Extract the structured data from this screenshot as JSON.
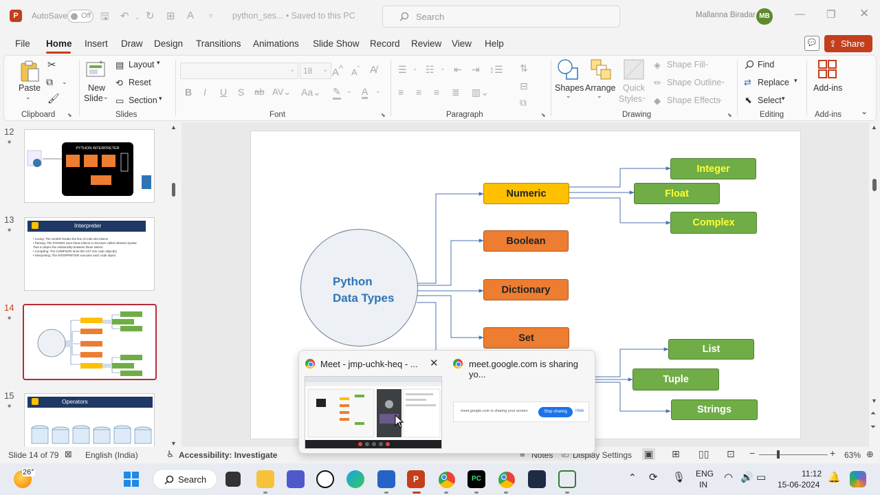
{
  "titlebar": {
    "app_letter": "P",
    "autosave_label": "AutoSave",
    "autosave_state": "Off",
    "doc_title": "python_ses... • Saved to this PC",
    "search_placeholder": "Search",
    "user_name": "Mallanna Biradar",
    "user_initials": "MB"
  },
  "menu": {
    "tabs": [
      "File",
      "Home",
      "Insert",
      "Draw",
      "Design",
      "Transitions",
      "Animations",
      "Slide Show",
      "Record",
      "Review",
      "View",
      "Help"
    ],
    "active": "Home",
    "share_label": "Share"
  },
  "ribbon": {
    "clipboard": {
      "paste": "Paste",
      "group": "Clipboard"
    },
    "slides": {
      "new_slide_1": "New",
      "new_slide_2": "Slide",
      "layout": "Layout",
      "reset": "Reset",
      "section": "Section",
      "group": "Slides"
    },
    "font": {
      "font_size": "18",
      "group": "Font"
    },
    "paragraph": {
      "group": "Paragraph"
    },
    "drawing": {
      "shapes": "Shapes",
      "arrange": "Arrange",
      "quick_1": "Quick",
      "quick_2": "Styles",
      "shape_fill": "Shape Fill",
      "shape_outline": "Shape Outline",
      "shape_effects": "Shape Effects",
      "group": "Drawing"
    },
    "editing": {
      "find": "Find",
      "replace": "Replace",
      "select": "Select",
      "group": "Editing"
    },
    "addins": {
      "label": "Add-ins",
      "group": "Add-ins"
    }
  },
  "slides_panel": {
    "slides": [
      {
        "number": "12",
        "caption": "PYTHON INTERPRETER"
      },
      {
        "number": "13",
        "caption": "Interpreter",
        "lines": [
          "• Lexing: The LEXER breaks the line of code into tokens",
          "• Parsing: The PARSER uses these tokens to structure called Abstract Syntax Tree to depict the relationship between these tokens",
          "• Compiling: The COMPILER turns this AST into code object(s)",
          "• Interpreting: The INTERPRETER executes each code object"
        ]
      },
      {
        "number": "14",
        "caption": ""
      },
      {
        "number": "15",
        "caption": "Operators"
      }
    ],
    "current": "14"
  },
  "slide": {
    "center_line1": "Python",
    "center_line2": "Data Types",
    "numeric": "Numeric",
    "integer": "Integer",
    "float": "Float",
    "complex": "Complex",
    "boolean": "Boolean",
    "dictionary": "Dictionary",
    "set": "Set",
    "list": "List",
    "tuple": "Tuple",
    "strings": "Strings"
  },
  "popup": {
    "tab1_title": "Meet - jmp-uchk-heq - ...",
    "tab2_title": "meet.google.com is sharing yo...",
    "sharing_text": "meet.google.com is sharing your screen",
    "stop_sharing": "Stop sharing",
    "hide": "Hide"
  },
  "status": {
    "slide_info": "Slide 14 of 79",
    "language": "English (India)",
    "accessibility": "Accessibility: Investigate",
    "notes": "Notes",
    "display_settings": "Display Settings",
    "zoom": "63%"
  },
  "taskbar": {
    "weather": "26°",
    "search": "Search",
    "lang1": "ENG",
    "lang2": "IN",
    "time": "11:12",
    "date": "15-06-2024"
  },
  "colors": {
    "accent": "#c43e1c",
    "numeric": "#ffc000",
    "orange": "#ed7d31",
    "green": "#70ad47",
    "title_blue": "#2e75b6"
  }
}
